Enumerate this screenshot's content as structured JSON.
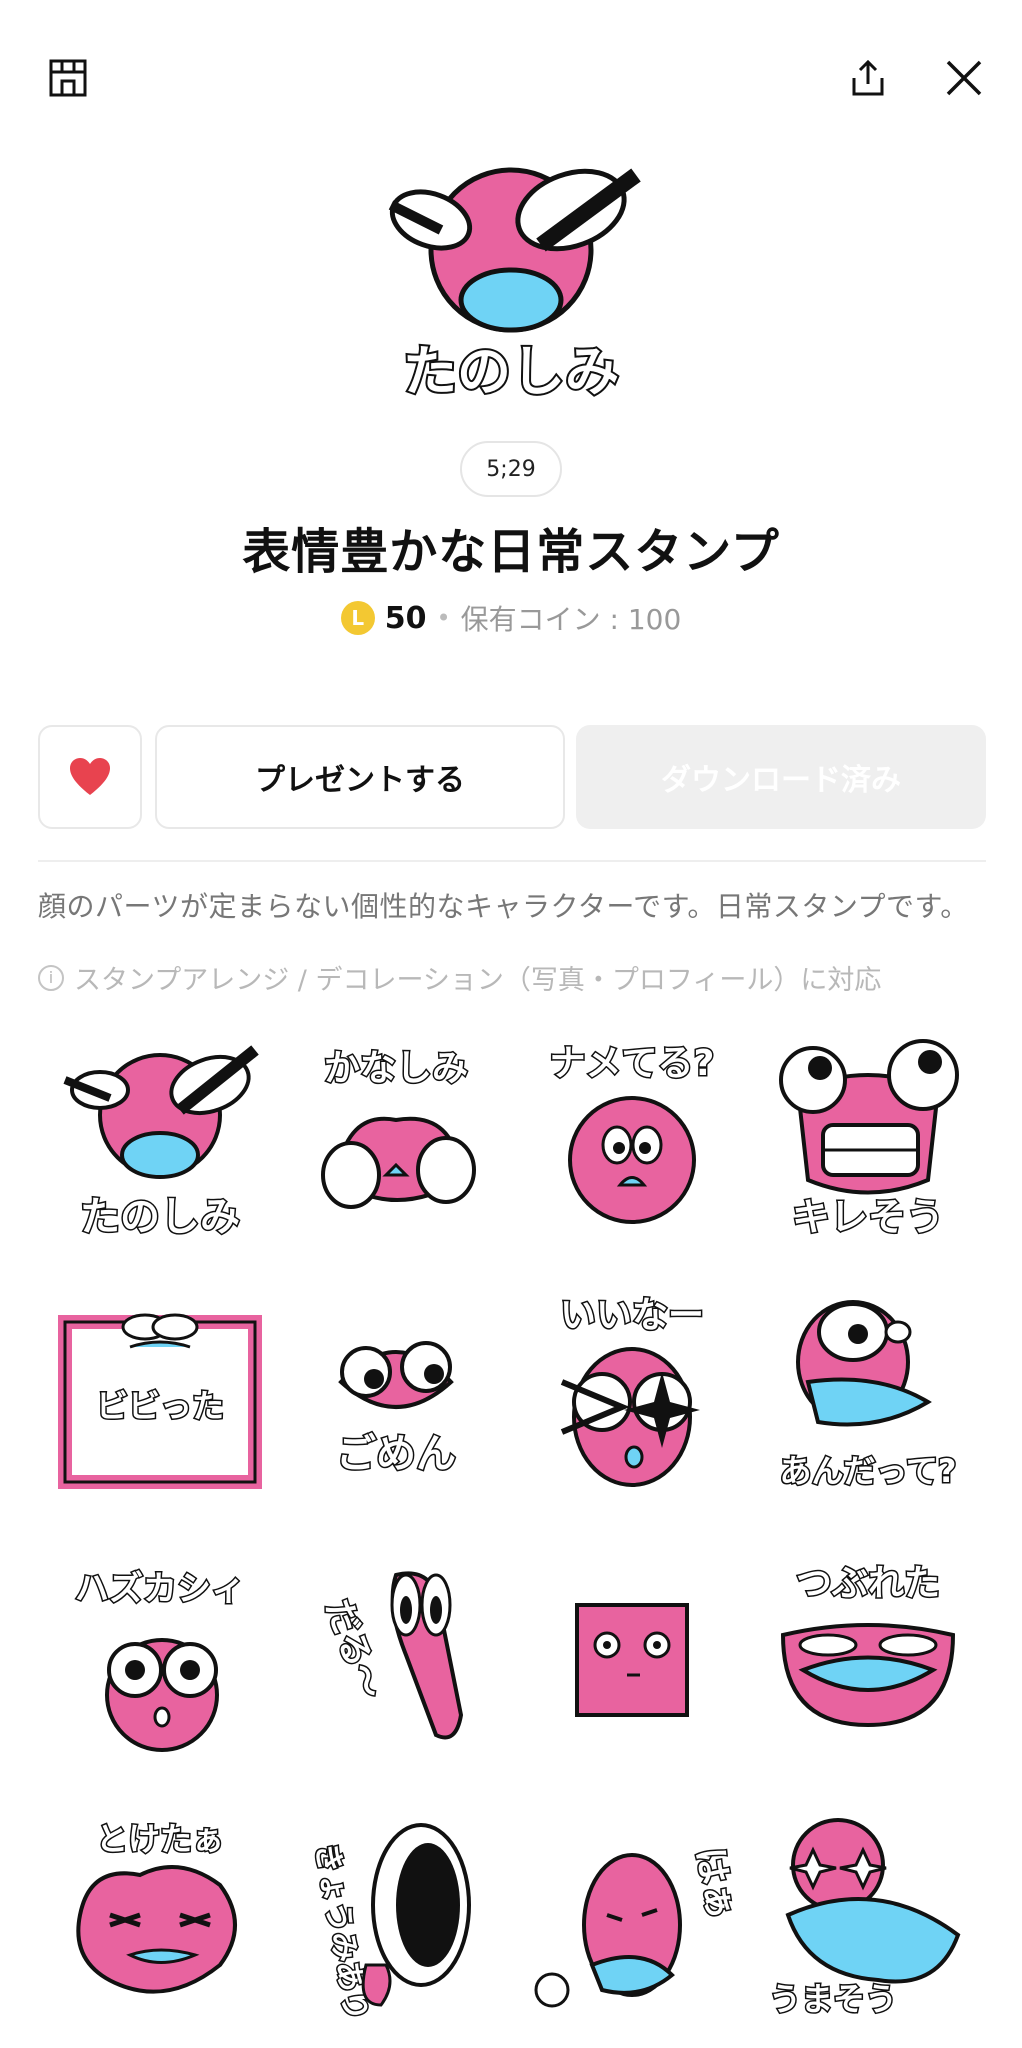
{
  "header": {
    "store_icon": "store-icon",
    "share_icon": "share-icon",
    "close_icon": "close-icon"
  },
  "hero": {
    "caption": "たのしみ"
  },
  "time_badge": "5;29",
  "title": "表情豊かな日常スタンプ",
  "price": {
    "coin_letter": "L",
    "amount": "50",
    "separator": "•",
    "owned": "保有コイン : 100"
  },
  "buttons": {
    "present": "プレゼントする",
    "download": "ダウンロード済み"
  },
  "description": "顔のパーツが定まらない個性的なキャラクターです。日常スタンプです。",
  "note": "スタンプアレンジ / デコレーション（写真・プロフィール）に対応",
  "stickers": [
    {
      "caption": "たのしみ"
    },
    {
      "caption": "かなしみ"
    },
    {
      "caption": "ナメてる?"
    },
    {
      "caption": "キレそう"
    },
    {
      "caption": "ビビった"
    },
    {
      "caption": "ごめん"
    },
    {
      "caption": "いいなー"
    },
    {
      "caption": "あんだって?"
    },
    {
      "caption": "ハズカシィ"
    },
    {
      "caption": "だる〜"
    },
    {
      "caption": ""
    },
    {
      "caption": "つぶれた"
    },
    {
      "caption": "とけたぁ"
    },
    {
      "caption": "きょうみあり"
    },
    {
      "caption": "はぁ"
    },
    {
      "caption": "うまそう"
    }
  ],
  "colors": {
    "pink": "#e8639f",
    "blue": "#6fd3f5",
    "heart": "#e8434f",
    "coin": "#f3c832"
  }
}
